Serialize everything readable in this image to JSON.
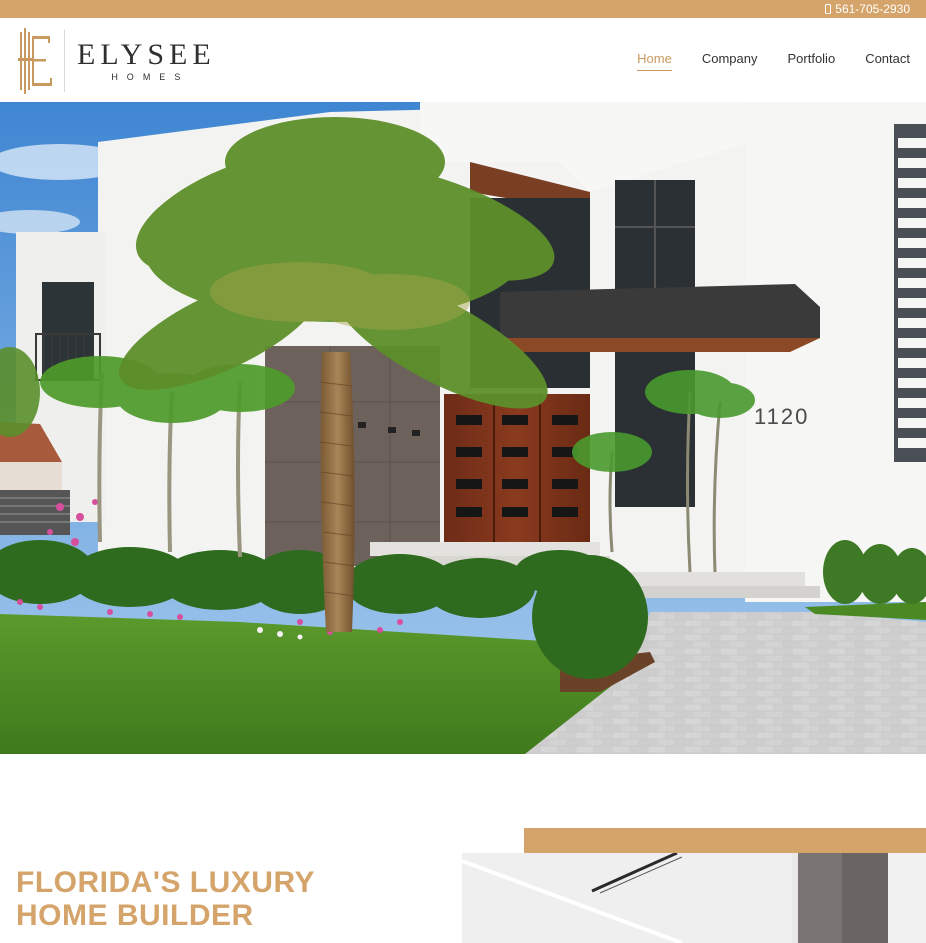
{
  "topbar": {
    "phone": "561-705-2930",
    "phone_icon": "phone-icon",
    "background": "#d4a46b"
  },
  "brand": {
    "name": "ELYSEE",
    "subtitle": "HOMES",
    "accent": "#c99a5f"
  },
  "nav": {
    "items": [
      {
        "label": "Home",
        "active": true
      },
      {
        "label": "Company",
        "active": false
      },
      {
        "label": "Portfolio",
        "active": false
      },
      {
        "label": "Contact",
        "active": false
      }
    ]
  },
  "hero": {
    "address_number": "1120"
  },
  "intro": {
    "headline_line1": "FLORIDA'S LUXURY",
    "headline_line2": "HOME BUILDER",
    "headline_color": "#d4a46b"
  }
}
